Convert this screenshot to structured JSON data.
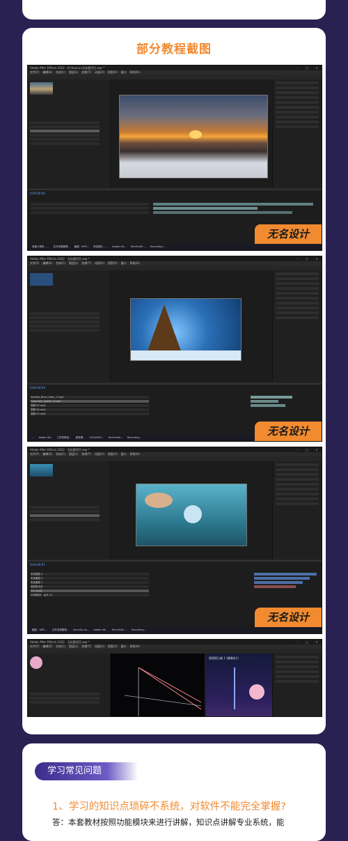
{
  "section_title": "部分教程截图",
  "screens": [
    {
      "window_title": "Adobe After Effects 2022 - D:\\haorun\\无标题项目.aep *",
      "menu": [
        "文件(F)",
        "编辑(E)",
        "合成(C)",
        "图层(L)",
        "效果(T)",
        "动画(A)",
        "视图(V)",
        "窗口",
        "帮助(H)"
      ],
      "comp_tab": "合成 A",
      "zoom": "(33.3%)",
      "timecode": "0:00:00:00",
      "taskbar": [
        "我爱计算机 - ...",
        "文件资源管理...",
        "截图 - WPS...",
        "抓拍图片 - ...",
        "Adobe Aft...",
        "TechSmith ...",
        "Recording..."
      ]
    },
    {
      "window_title": "Adobe After Effects 2022 - 无标题项目.aep *",
      "menu": [
        "文件(F)",
        "编辑(E)",
        "合成(C)",
        "图层(L)",
        "效果(T)",
        "动画(A)",
        "视图(V)",
        "窗口",
        "帮助(H)"
      ],
      "comp_tab": "合成 风雪",
      "layers": [
        "Sparkle_Blue_Clean_1.mp4",
        "Fullscreen_Bokeh_3.mp4",
        "视频 05.mp4",
        "视频 08.mp4",
        "视频 03.mp4"
      ],
      "timecode": "0:00:04:04",
      "taskbar": [
        "...",
        "Adobe Aft...",
        "兰亭的教室...",
        "爱剪辑...",
        "20220615...",
        "TechSmith...",
        "Recording..."
      ]
    },
    {
      "window_title": "Adobe After Effects 2022 - 无标题项目.aep *",
      "menu": [
        "文件(F)",
        "编辑(E)",
        "合成(C)",
        "图层(L)",
        "效果(T)",
        "动画(A)",
        "视图(V)",
        "窗口",
        "帮助(H)"
      ],
      "comp_tab": "合成 1",
      "layers": [
        "形状图层 3",
        "形状图层 2",
        "形状图层 1",
        "底层条合并",
        "[01.mp4]",
        "[中间形状 - 后半 1]"
      ],
      "timecode": "0:00:00:07",
      "taskbar": [
        "截图 - WPS ...",
        "文件资源管理...",
        "Security an...",
        "Adobe Aft...",
        "TechSmith ...",
        "Recording..."
      ]
    },
    {
      "window_title": "Adobe After Effects 2022 - 无标题项目.aep *",
      "menu": [
        "文件(F)",
        "编辑(E)",
        "合成(C)",
        "图层(L)",
        "效果(T)",
        "动画(A)",
        "视图(V)",
        "窗口",
        "帮助(H)"
      ],
      "comp_tab": "合成 光线",
      "preview_label": "透视提示器 1 (摄像机1)"
    }
  ],
  "watermark": "无名设计",
  "faq": {
    "title": "学习常见问题",
    "question": "1、学习的知识点琐碎不系统，对软件不能完全掌握?",
    "answer": "答：本套教材按照功能模块来进行讲解，知识点讲解专业系统，能"
  },
  "colors": {
    "accent": "#f28a30",
    "background": "#2a2153",
    "ae_blue": "#5aa6ff"
  }
}
